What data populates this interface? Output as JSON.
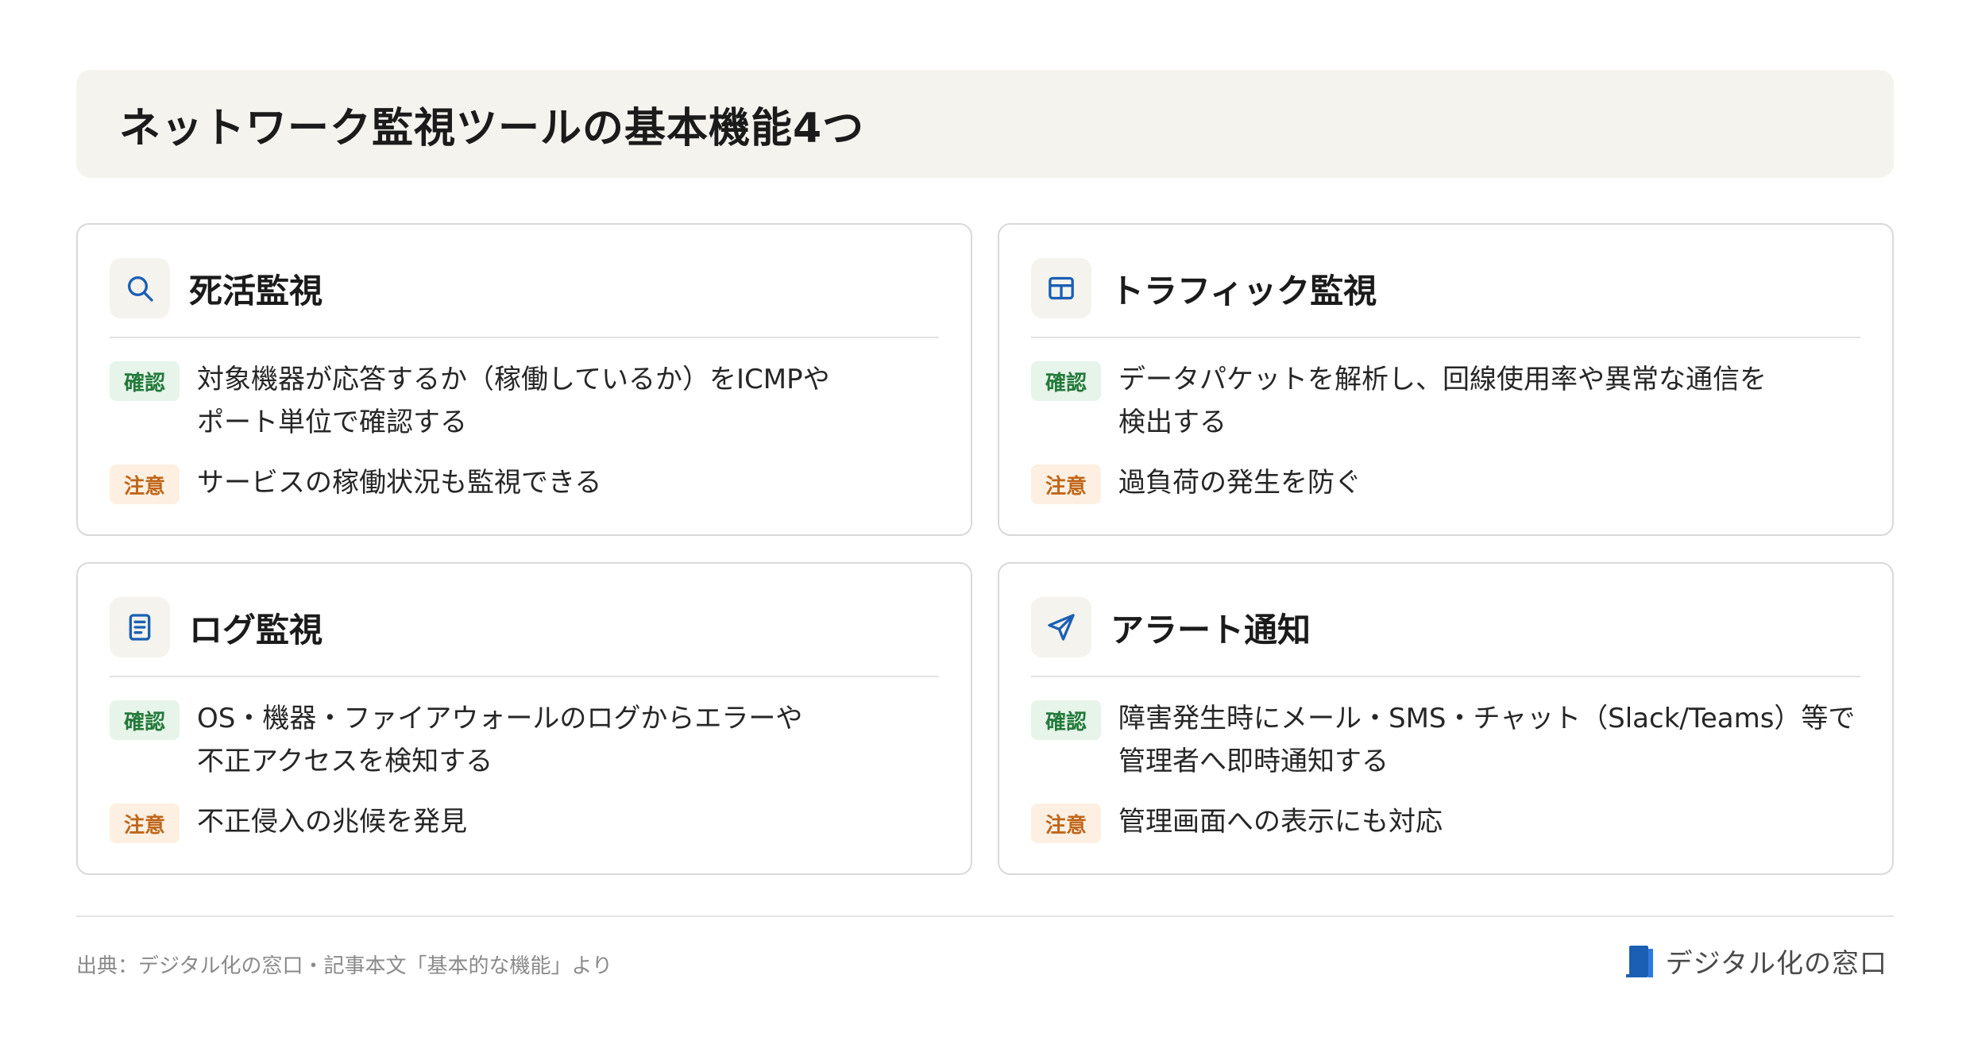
{
  "header": {
    "title": "ネットワーク監視ツールの基本機能4つ"
  },
  "cards": [
    {
      "icon": "search-icon",
      "title": "死活監視",
      "confirm_tag": "確認",
      "confirm_text": "対象機器が応答するか（稼働しているか）をICMPや\nポート単位で確認する",
      "note_tag": "注意",
      "note_text": "サービスの稼働状況も監視できる"
    },
    {
      "icon": "layout-grid-icon",
      "title": "トラフィック監視",
      "confirm_tag": "確認",
      "confirm_text": "データパケットを解析し、回線使用率や異常な通信を\n検出する",
      "note_tag": "注意",
      "note_text": "過負荷の発生を防ぐ"
    },
    {
      "icon": "document-icon",
      "title": "ログ監視",
      "confirm_tag": "確認",
      "confirm_text": "OS・機器・ファイアウォールのログからエラーや\n不正アクセスを検知する",
      "note_tag": "注意",
      "note_text": "不正侵入の兆候を発見"
    },
    {
      "icon": "send-icon",
      "title": "アラート通知",
      "confirm_tag": "確認",
      "confirm_text": "障害発生時にメール・SMS・チャット（Slack/Teams）等で\n管理者へ即時通知する",
      "note_tag": "注意",
      "note_text": "管理画面への表示にも対応"
    }
  ],
  "footer": {
    "source": "出典：デジタル化の窓口・記事本文「基本的な機能」より",
    "brand": "デジタル化の窓口"
  },
  "colors": {
    "accent_blue": "#1a5fb4",
    "confirm_green": "#237a3b",
    "note_orange": "#c0661a",
    "band_beige": "#f5f3ee"
  }
}
